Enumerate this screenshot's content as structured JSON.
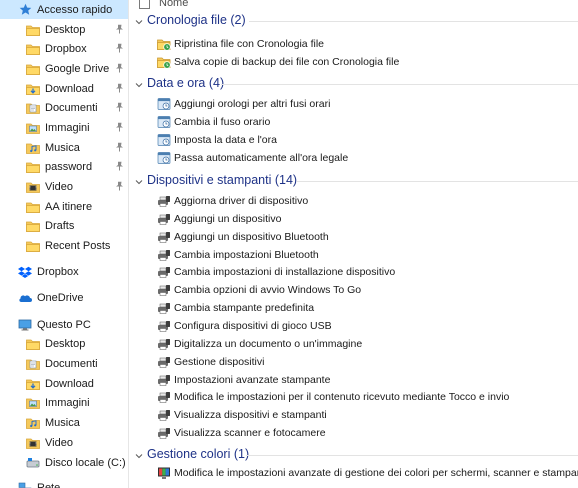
{
  "sidebar": {
    "items": [
      {
        "label": "Accesso rapido",
        "icon": "star-icon",
        "pinned": false,
        "selected": true
      },
      {
        "label": "Desktop",
        "icon": "folder-icon",
        "pinned": true
      },
      {
        "label": "Dropbox",
        "icon": "folder-icon",
        "pinned": true
      },
      {
        "label": "Google Drive",
        "icon": "folder-icon",
        "pinned": true
      },
      {
        "label": "Download",
        "icon": "download-icon",
        "pinned": true
      },
      {
        "label": "Documenti",
        "icon": "documents-icon",
        "pinned": true
      },
      {
        "label": "Immagini",
        "icon": "pictures-icon",
        "pinned": true
      },
      {
        "label": "Musica",
        "icon": "music-icon",
        "pinned": true
      },
      {
        "label": "password",
        "icon": "folder-icon",
        "pinned": true
      },
      {
        "label": "Video",
        "icon": "video-icon",
        "pinned": true
      },
      {
        "label": "AA itinere",
        "icon": "folder-icon",
        "pinned": false
      },
      {
        "label": "Drafts",
        "icon": "folder-icon",
        "pinned": false
      },
      {
        "label": "Recent Posts",
        "icon": "folder-icon",
        "pinned": false
      },
      {
        "label": "Dropbox",
        "icon": "dropbox-icon",
        "pinned": false
      },
      {
        "label": "OneDrive",
        "icon": "onedrive-icon",
        "pinned": false
      },
      {
        "label": "Questo PC",
        "icon": "computer-icon",
        "pinned": false
      },
      {
        "label": "Desktop",
        "icon": "folder-icon",
        "pinned": false
      },
      {
        "label": "Documenti",
        "icon": "documents-icon",
        "pinned": false
      },
      {
        "label": "Download",
        "icon": "download-icon",
        "pinned": false
      },
      {
        "label": "Immagini",
        "icon": "pictures-icon",
        "pinned": false
      },
      {
        "label": "Musica",
        "icon": "music-icon",
        "pinned": false
      },
      {
        "label": "Video",
        "icon": "video-icon",
        "pinned": false
      },
      {
        "label": "Disco locale (C:)",
        "icon": "drive-icon",
        "pinned": false
      },
      {
        "label": "Rete",
        "icon": "network-icon",
        "pinned": false
      }
    ]
  },
  "content": {
    "column_name": "Nome",
    "groups": [
      {
        "title": "Cronologia file (2)",
        "icon": "file-history-icon",
        "items": [
          "Ripristina file con Cronologia file",
          "Salva copie di backup dei file con Cronologia file"
        ]
      },
      {
        "title": "Data e ora (4)",
        "icon": "clock-icon",
        "items": [
          "Aggiungi orologi per altri fusi orari",
          "Cambia il fuso orario",
          "Imposta la data e l'ora",
          "Passa automaticamente all'ora legale"
        ]
      },
      {
        "title": "Dispositivi e stampanti (14)",
        "icon": "devices-printers-icon",
        "items": [
          "Aggiorna driver di dispositivo",
          "Aggiungi un dispositivo",
          "Aggiungi un dispositivo Bluetooth",
          "Cambia impostazioni Bluetooth",
          "Cambia impostazioni di installazione dispositivo",
          "Cambia opzioni di avvio Windows To Go",
          "Cambia stampante predefinita",
          "Configura dispositivi di gioco USB",
          "Digitalizza un documento o un'immagine",
          "Gestione dispositivi",
          "Impostazioni avanzate stampante",
          "Modifica le impostazioni per il contenuto ricevuto mediante Tocco e invio",
          "Visualizza dispositivi e stampanti",
          "Visualizza scanner e fotocamere"
        ]
      },
      {
        "title": "Gestione colori (1)",
        "icon": "color-management-icon",
        "items": [
          "Modifica le impostazioni avanzate di gestione dei colori per schermi, scanner e stampanti"
        ]
      }
    ]
  },
  "colors": {
    "group_title": "#1e3287",
    "selected_bg": "#cce8ff",
    "folder": "#e8b84a"
  }
}
